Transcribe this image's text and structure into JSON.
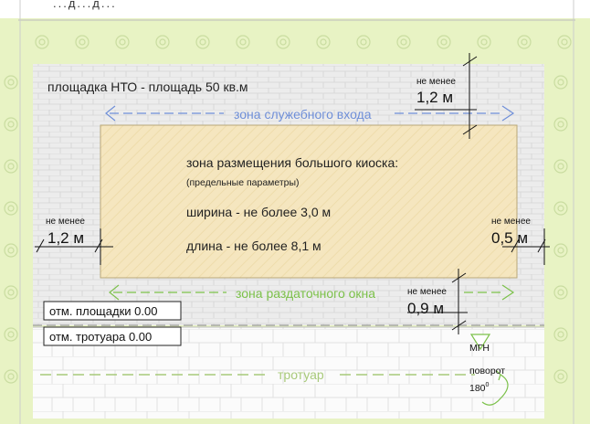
{
  "top_caption": "...д...д...",
  "site_label": "площадка НТО - площадь 50 кв.м",
  "zones": {
    "service_entrance": "зона служебного входа",
    "serving_window": "зона раздаточного окна",
    "sidewalk": "тротуар"
  },
  "kiosk": {
    "title": "зона размещения большого киоска:",
    "subtitle": "(предельные параметры)",
    "width_text": "ширина - не более 3,0 м",
    "length_text": "длина - не более 8,1 м"
  },
  "dimensions": {
    "top": {
      "label": "не менее",
      "value": "1,2 м"
    },
    "left": {
      "label": "не менее",
      "value": "1,2 м"
    },
    "right": {
      "label": "не менее",
      "value": "0,5 м"
    },
    "bottom": {
      "label": "не менее",
      "value": "0,9 м"
    }
  },
  "elevations": {
    "site": "отм. площадки 0.00",
    "sidewalk": "отм. тротуара 0.00"
  },
  "mgn": {
    "line1": "МГН",
    "line2": "поворот",
    "line3": "180",
    "degree": "0"
  },
  "colors": {
    "greenery": "#e8f3c4",
    "paving": "#ececec",
    "kiosk_fill": "#f5e6bf",
    "service_zone": "#6f8fd8",
    "window_zone": "#7cc14a",
    "sidewalk_line": "#a8c97a"
  }
}
